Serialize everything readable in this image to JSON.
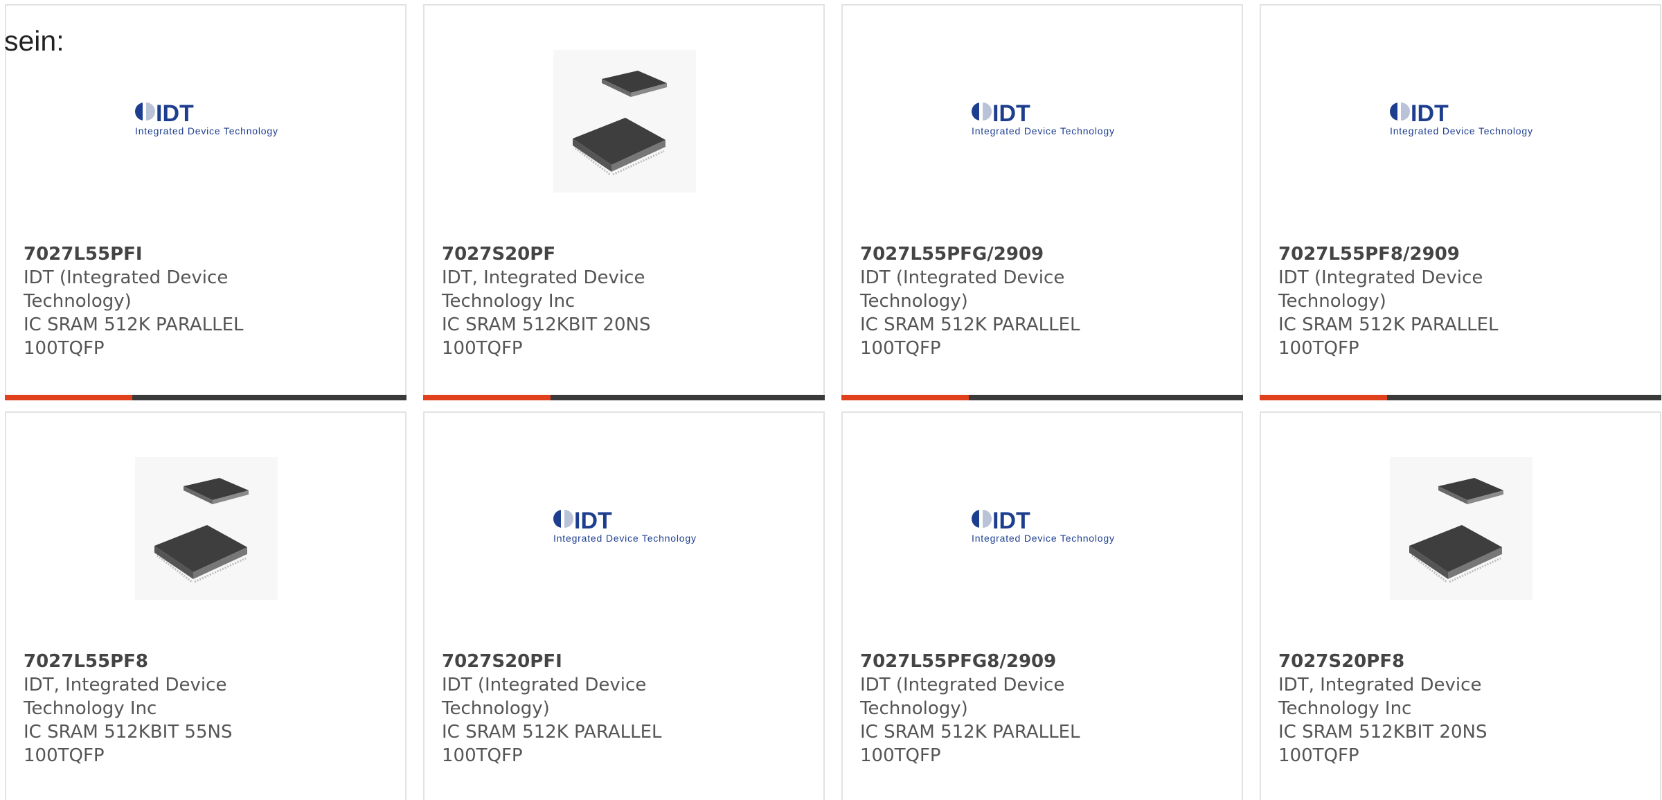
{
  "intro": "sein:",
  "colors": {
    "accent": "#e0401b",
    "bar_dark": "#3a3a3a",
    "idt_blue": "#1d3e8f"
  },
  "logo": {
    "mark": "IDT",
    "tagline": "Integrated Device Technology"
  },
  "products": [
    {
      "part": "7027L55PFI",
      "maker1": "IDT (Integrated Device",
      "maker2": "Technology)",
      "desc1": "IC SRAM 512K PARALLEL",
      "desc2": "100TQFP",
      "image": "idt-logo-icon"
    },
    {
      "part": "7027S20PF",
      "maker1": "IDT, Integrated Device",
      "maker2": "Technology Inc",
      "desc1": "IC SRAM 512KBIT 20NS 100TQFP",
      "desc2": "",
      "image": "tqfp-chip-icon"
    },
    {
      "part": "7027L55PFG/2909",
      "maker1": "IDT (Integrated Device",
      "maker2": "Technology)",
      "desc1": "IC SRAM 512K PARALLEL",
      "desc2": "100TQFP",
      "image": "idt-logo-icon"
    },
    {
      "part": "7027L55PF8/2909",
      "maker1": "IDT (Integrated Device",
      "maker2": "Technology)",
      "desc1": "IC SRAM 512K PARALLEL",
      "desc2": "100TQFP",
      "image": "idt-logo-icon"
    },
    {
      "part": "7027L55PF8",
      "maker1": "IDT, Integrated Device",
      "maker2": "Technology Inc",
      "desc1": "IC SRAM 512KBIT 55NS 100TQFP",
      "desc2": "",
      "image": "tqfp-chip-icon"
    },
    {
      "part": "7027S20PFI",
      "maker1": "IDT (Integrated Device",
      "maker2": "Technology)",
      "desc1": "IC SRAM 512K PARALLEL",
      "desc2": "100TQFP",
      "image": "idt-logo-icon"
    },
    {
      "part": "7027L55PFG8/2909",
      "maker1": "IDT (Integrated Device",
      "maker2": "Technology)",
      "desc1": "IC SRAM 512K PARALLEL",
      "desc2": "100TQFP",
      "image": "idt-logo-icon"
    },
    {
      "part": "7027S20PF8",
      "maker1": "IDT, Integrated Device",
      "maker2": "Technology Inc",
      "desc1": "IC SRAM 512KBIT 20NS 100TQFP",
      "desc2": "",
      "image": "tqfp-chip-icon"
    }
  ]
}
